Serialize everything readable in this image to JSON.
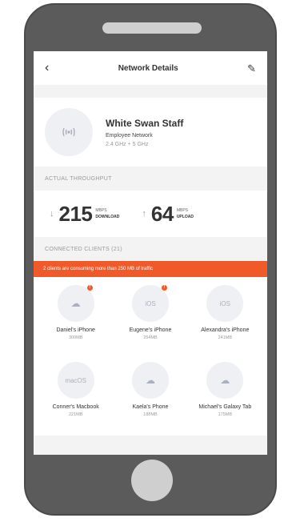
{
  "navbar": {
    "back_icon": "back-chevron-icon",
    "title": "Network Details",
    "edit_icon": "pencil-icon"
  },
  "network": {
    "icon": "router-icon",
    "name": "White Swan Staff",
    "type": "Employee Network",
    "bands": "2.4 GHz + 5 GHz"
  },
  "throughput": {
    "section_title": "ACTUAL THROUGHPUT",
    "download": {
      "value": "215",
      "unit": "MBPS",
      "label": "DOWNLOAD",
      "icon": "arrow-down-icon"
    },
    "upload": {
      "value": "64",
      "unit": "MBPS",
      "label": "UPLOAD",
      "icon": "arrow-up-icon"
    }
  },
  "clients_section": {
    "title": "CONNECTED CLIENTS (21)",
    "alert": "2 clients are consuming more than 250 MB of traffic"
  },
  "clients": [
    {
      "name": "Daniel's iPhone",
      "usage": "300MB",
      "avatar": "cloud-icon",
      "alert": true
    },
    {
      "name": "Eugene's iPhone",
      "usage": "254MB",
      "avatar": "iOS",
      "alert": true
    },
    {
      "name": "Alexandra's iPhone",
      "usage": "241MB",
      "avatar": "iOS",
      "alert": false
    },
    {
      "name": "Conner's Macbook",
      "usage": "221MB",
      "avatar": "macOS",
      "alert": false
    },
    {
      "name": "Kaela's Phone",
      "usage": "188MB",
      "avatar": "cloud-icon",
      "alert": false
    },
    {
      "name": "Michael's Galaxy Tab",
      "usage": "175MB",
      "avatar": "cloud-icon",
      "alert": false
    }
  ],
  "colors": {
    "alert": "#f05a2a",
    "phone_body": "#5b5b5b",
    "avatar_bg": "#eef0f4"
  }
}
